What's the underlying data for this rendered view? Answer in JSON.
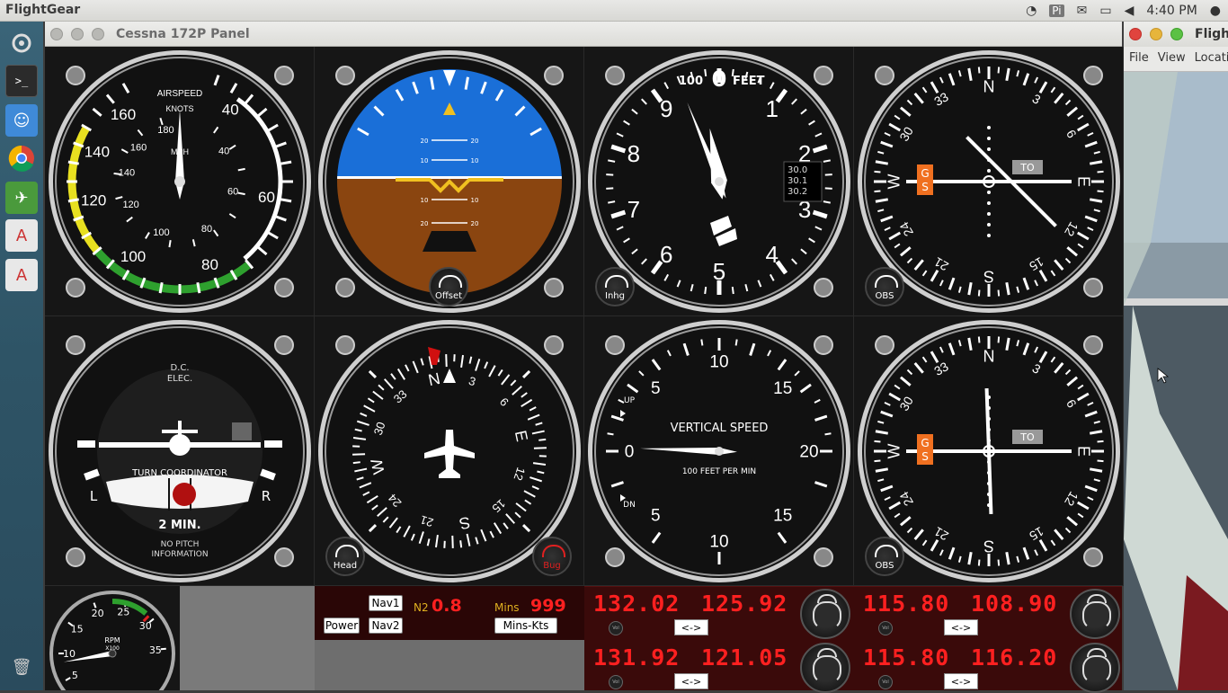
{
  "topbar": {
    "app_name": "FlightGear",
    "clock": "4:40 PM",
    "indicator_pi": "Pi"
  },
  "panel_window": {
    "title": "Cessna 172P Panel"
  },
  "right_window": {
    "title": "Fligh",
    "menu": [
      "File",
      "View",
      "Locatio"
    ]
  },
  "launcher": {
    "items": [
      "dash-home",
      "terminal",
      "finder",
      "chrome",
      "flightgear",
      "text-editor-1",
      "text-editor-2",
      "trash"
    ]
  },
  "instruments": {
    "airspeed": {
      "label1": "AIRSPEED",
      "label2": "KNOTS",
      "label3": "MPH",
      "knots_ticks": [
        "40",
        "60",
        "80",
        "100",
        "120",
        "140",
        "160"
      ],
      "mph_ticks": [
        "40",
        "60",
        "80",
        "100",
        "120",
        "140",
        "160",
        "180"
      ]
    },
    "attitude": {
      "pitch_labels": [
        "20",
        "10",
        "10",
        "20"
      ],
      "knob": "Offset"
    },
    "altimeter": {
      "header_hundreds": "100",
      "header_feet": "FEET",
      "digits": [
        "0",
        "1",
        "2",
        "3",
        "4",
        "5",
        "6",
        "7",
        "8",
        "9"
      ],
      "kollsman": [
        "30.0",
        "30.1",
        "30.2"
      ],
      "knob": "Inhg"
    },
    "vor1": {
      "cardinals": [
        "N",
        "E",
        "S",
        "W"
      ],
      "numbers": [
        "3",
        "6",
        "12",
        "15",
        "21",
        "24",
        "30",
        "33"
      ],
      "gs": "GS",
      "to": "TO",
      "knob": "OBS"
    },
    "turn_coordinator": {
      "line1": "D.C.",
      "line2": "ELEC.",
      "title": "TURN COORDINATOR",
      "left": "L",
      "right": "R",
      "minutes": "2 MIN.",
      "note1": "NO PITCH",
      "note2": "INFORMATION"
    },
    "heading": {
      "cardinals": [
        "N",
        "E",
        "S",
        "W"
      ],
      "numbers": [
        "3",
        "6",
        "12",
        "15",
        "21",
        "24",
        "30",
        "33"
      ],
      "knob_left": "Head",
      "knob_right": "Bug"
    },
    "vsi": {
      "title": "VERTICAL SPEED",
      "subtitle": "100 FEET PER MIN",
      "ticks": [
        "0",
        "5",
        "10",
        "15",
        "20",
        "15",
        "10",
        "5"
      ],
      "up": "UP",
      "dn": "DN"
    },
    "vor2": {
      "cardinals": [
        "N",
        "E",
        "S",
        "W"
      ],
      "numbers": [
        "3",
        "6",
        "12",
        "15",
        "21",
        "24",
        "30",
        "33"
      ],
      "gs": "GS",
      "to": "TO",
      "knob": "OBS"
    },
    "tach": {
      "label": "RPM",
      "sub": "X100",
      "ticks": [
        "5",
        "10",
        "15",
        "20",
        "25",
        "30",
        "35"
      ]
    }
  },
  "dme": {
    "nav1": "Nav1",
    "nav2": "Nav2",
    "power": "Power",
    "n2": "N2",
    "n2_value": "0.8",
    "mins": "Mins",
    "mins_value": "999",
    "mins_kts": "Mins-Kts"
  },
  "comm": {
    "comm1_active": "132.02",
    "comm1_standby": "125.92",
    "comm2_active": "131.92",
    "comm2_standby": "121.05",
    "swap": "<->",
    "vol": "Vol"
  },
  "nav": {
    "nav1_active": "115.80",
    "nav1_standby": "108.90",
    "nav2_active": "115.80",
    "nav2_standby": "116.20",
    "swap": "<->",
    "vol": "Vol"
  },
  "colors": {
    "sky": "#1a6fd8",
    "ground": "#8a4510",
    "radio_text": "#ff2020",
    "dme_text": "#ff2020",
    "mins_label": "#e0b020"
  }
}
